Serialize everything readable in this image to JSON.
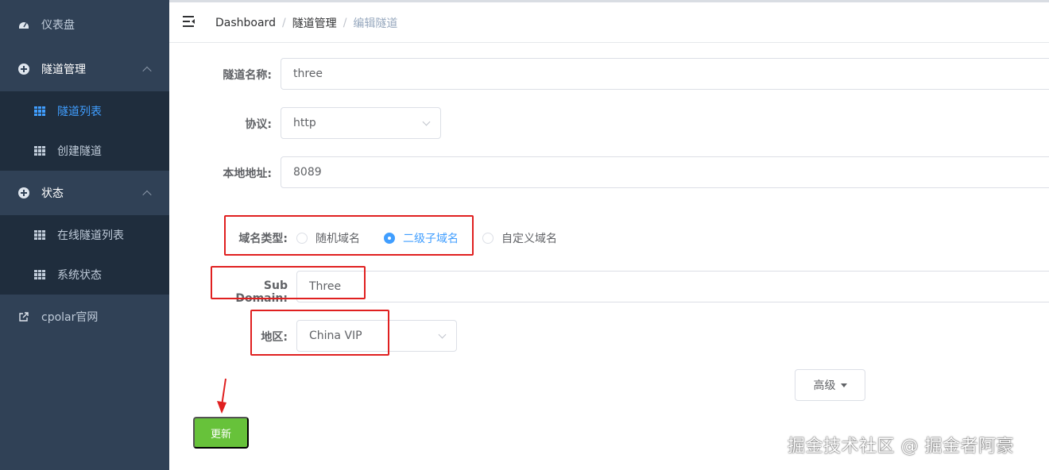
{
  "sidebar": {
    "items": [
      {
        "label": "仪表盘",
        "icon": "dashboard-icon"
      },
      {
        "label": "隧道管理",
        "icon": "circle-plus-icon"
      },
      {
        "label": "隧道列表",
        "icon": "table-icon",
        "active": true
      },
      {
        "label": "创建隧道",
        "icon": "table-icon"
      },
      {
        "label": "状态",
        "icon": "circle-plus-icon"
      },
      {
        "label": "在线隧道列表",
        "icon": "table-icon"
      },
      {
        "label": "系统状态",
        "icon": "table-icon"
      },
      {
        "label": "cpolar官网",
        "icon": "external-link-icon"
      }
    ]
  },
  "breadcrumb": {
    "items": [
      "Dashboard",
      "隧道管理",
      "编辑隧道"
    ],
    "separator": "/"
  },
  "form": {
    "tunnel_name_label": "隧道名称:",
    "tunnel_name_value": "three",
    "protocol_label": "协议:",
    "protocol_value": "http",
    "local_address_label": "本地地址:",
    "local_address_value": "8089",
    "domain_type_label": "域名类型:",
    "domain_type_options": [
      "随机域名",
      "二级子域名",
      "自定义域名"
    ],
    "domain_type_selected": "二级子域名",
    "subdomain_label": "Sub Domain:",
    "subdomain_value": "Three",
    "region_label": "地区:",
    "region_value": "China VIP",
    "advanced_label": "高级",
    "update_label": "更新"
  },
  "watermark": "掘金技术社区 @ 掘金者阿豪",
  "colors": {
    "sidebar_bg": "#304156",
    "submenu_bg": "#1f2d3d",
    "active": "#409eff",
    "update_button": "#67c23a",
    "annotation": "#e02020"
  }
}
